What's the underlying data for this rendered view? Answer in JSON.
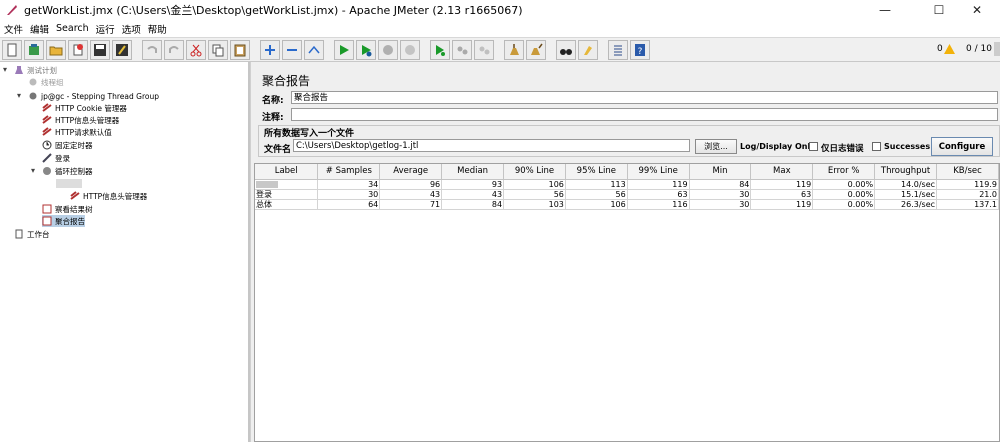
{
  "window": {
    "title": "getWorkList.jmx (C:\\Users\\金兰\\Desktop\\getWorkList.jmx) - Apache JMeter (2.13 r1665067)"
  },
  "menu": [
    "文件",
    "编辑",
    "Search",
    "运行",
    "选项",
    "帮助"
  ],
  "toolbar": {
    "warnings": "0",
    "threads": "0 / 10"
  },
  "tree": [
    {
      "label": "测试计划",
      "icon": "flask-icon"
    },
    {
      "label": "线程组",
      "icon": "gear-icon"
    },
    {
      "label": "jp@gc - Stepping Thread Group",
      "icon": "gear-icon"
    },
    {
      "label": "HTTP Cookie 管理器",
      "icon": "config-icon"
    },
    {
      "label": "HTTP信息头管理器",
      "icon": "config-icon"
    },
    {
      "label": "HTTP请求默认值",
      "icon": "config-icon"
    },
    {
      "label": "固定定时器",
      "icon": "timer-icon"
    },
    {
      "label": "登录",
      "icon": "sampler-icon"
    },
    {
      "label": "循环控制器",
      "icon": "controller-icon"
    },
    {
      "label": "HTTP信息头管理器",
      "icon": "config-icon"
    },
    {
      "label": "察看结果树",
      "icon": "listener-icon"
    },
    {
      "label": "聚合报告",
      "icon": "listener-icon"
    },
    {
      "label": "工作台",
      "icon": "workbench-icon"
    }
  ],
  "report": {
    "heading": "聚合报告",
    "name_label": "名称:",
    "name_value": "聚合报告",
    "comment_label": "注释:",
    "comment_value": "",
    "file_section": "所有数据写入一个文件",
    "file_label": "文件名",
    "file_value": "C:\\Users\\Desktop\\getlog-1.jtl",
    "browse_label": "浏览...",
    "log_display_label": "Log/Display Only:",
    "errors_only_label": "仅日志错误",
    "successes_label": "Successes",
    "configure_label": "Configure"
  },
  "table": {
    "columns": [
      "Label",
      "# Samples",
      "Average",
      "Median",
      "90% Line",
      "95% Line",
      "99% Line",
      "Min",
      "Max",
      "Error %",
      "Throughput",
      "KB/sec"
    ],
    "rows": [
      [
        "",
        "34",
        "96",
        "93",
        "106",
        "113",
        "119",
        "84",
        "119",
        "0.00%",
        "14.0/sec",
        "119.9"
      ],
      [
        "登录",
        "30",
        "43",
        "43",
        "56",
        "56",
        "63",
        "30",
        "63",
        "0.00%",
        "15.1/sec",
        "21.0"
      ],
      [
        "总体",
        "64",
        "71",
        "84",
        "103",
        "106",
        "116",
        "30",
        "119",
        "0.00%",
        "26.3/sec",
        "137.1"
      ]
    ]
  }
}
